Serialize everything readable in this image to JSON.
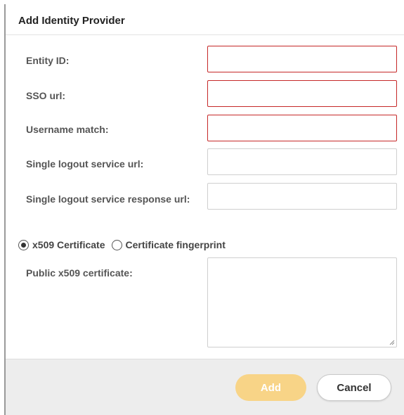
{
  "dialog": {
    "title": "Add Identity Provider"
  },
  "fields": {
    "entity_id": {
      "label": "Entity ID:",
      "value": ""
    },
    "sso_url": {
      "label": "SSO url:",
      "value": ""
    },
    "username_match": {
      "label": "Username match:",
      "value": ""
    },
    "slo_url": {
      "label": "Single logout service url:",
      "value": ""
    },
    "slo_response_url": {
      "label": "Single logout service response url:",
      "value": ""
    },
    "public_cert": {
      "label": "Public x509 certificate:",
      "value": ""
    }
  },
  "cert_type": {
    "options": [
      {
        "label": "x509 Certificate",
        "selected": true
      },
      {
        "label": "Certificate fingerprint",
        "selected": false
      }
    ]
  },
  "buttons": {
    "add_label": "Add",
    "cancel_label": "Cancel"
  },
  "colors": {
    "invalid_border": "#c62828",
    "add_button_bg": "#f8d487",
    "footer_bg": "#ededed"
  }
}
